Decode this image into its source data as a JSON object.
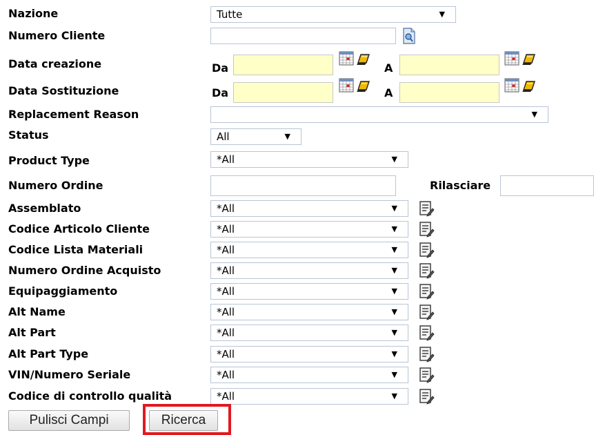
{
  "form": {
    "nazione": {
      "label": "Nazione",
      "value": "Tutte"
    },
    "numero_cliente": {
      "label": "Numero Cliente",
      "value": ""
    },
    "data_creazione": {
      "label": "Data creazione",
      "from_label": "Da",
      "to_label": "A",
      "from_value": "",
      "to_value": ""
    },
    "data_sostituzione": {
      "label": "Data Sostituzione",
      "from_label": "Da",
      "to_label": "A",
      "from_value": "",
      "to_value": ""
    },
    "replacement_reason": {
      "label": "Replacement Reason",
      "value": ""
    },
    "status": {
      "label": "Status",
      "value": "All"
    },
    "product_type": {
      "label": "Product Type",
      "value": "*All"
    },
    "numero_ordine": {
      "label": "Numero Ordine",
      "value": ""
    },
    "rilasciare": {
      "label": "Rilasciare",
      "value": ""
    },
    "filters": [
      {
        "label": "Assemblato",
        "value": "*All"
      },
      {
        "label": "Codice Articolo Cliente",
        "value": "*All"
      },
      {
        "label": "Codice Lista Materiali",
        "value": "*All"
      },
      {
        "label": "Numero Ordine Acquisto",
        "value": "*All"
      },
      {
        "label": "Equipaggiamento",
        "value": "*All"
      },
      {
        "label": "Alt Name",
        "value": "*All"
      },
      {
        "label": "Alt Part",
        "value": "*All"
      },
      {
        "label": "Alt Part Type",
        "value": "*All"
      },
      {
        "label": "VIN/Numero Seriale",
        "value": "*All"
      },
      {
        "label": "Codice di controllo qualità",
        "value": "*All"
      }
    ]
  },
  "buttons": {
    "clear_label": "Pulisci Campi",
    "search_label": "Ricerca"
  },
  "icons": {
    "calendar": "calendar-icon",
    "eraser": "eraser-icon",
    "lookup": "lookup-icon",
    "edit_list": "edit-list-icon"
  },
  "colors": {
    "date_field_bg": "#ffffc8",
    "highlight_border": "#e0191f",
    "field_border": "#b9c4d4"
  }
}
